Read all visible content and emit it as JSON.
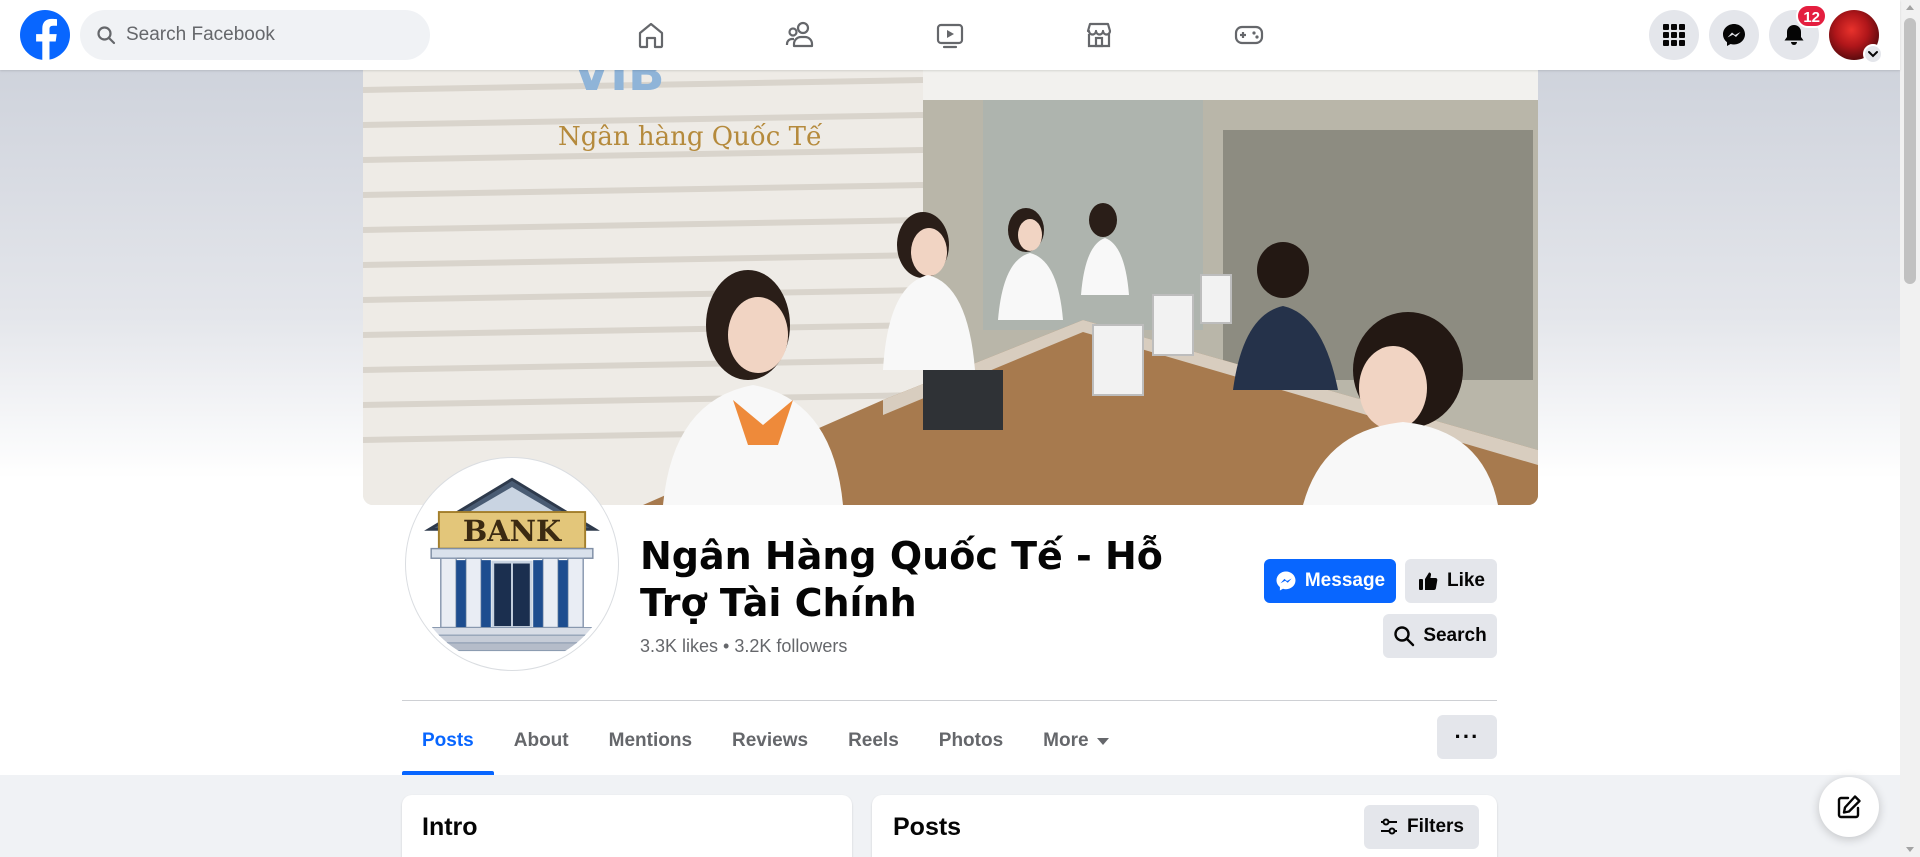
{
  "topbar": {
    "search_placeholder": "Search Facebook",
    "nav": [
      {
        "icon": "home-icon"
      },
      {
        "icon": "friends-icon"
      },
      {
        "icon": "video-icon"
      },
      {
        "icon": "marketplace-icon"
      },
      {
        "icon": "gaming-icon"
      }
    ],
    "notification_count": "12"
  },
  "page": {
    "name": "Ngân Hàng Quốc Tế - Hỗ Trợ Tài Chính",
    "stats": "3.3K likes • 3.2K followers",
    "profile_logo_text": "BANK",
    "cover_sign_text": "Ngân hàng Quốc Tế",
    "cover_brand_text": "VIB"
  },
  "actions": {
    "message_label": "Message",
    "like_label": "Like",
    "search_label": "Search"
  },
  "tabs": [
    {
      "label": "Posts",
      "active": true
    },
    {
      "label": "About"
    },
    {
      "label": "Mentions"
    },
    {
      "label": "Reviews"
    },
    {
      "label": "Reels"
    },
    {
      "label": "Photos"
    },
    {
      "label": "More"
    }
  ],
  "more_options_label": "···",
  "intro_card": {
    "title": "Intro"
  },
  "posts_card": {
    "title": "Posts",
    "filters_label": "Filters"
  },
  "colors": {
    "brand": "#0866ff",
    "badge": "#e41e3f",
    "muted_text": "#65676b"
  }
}
